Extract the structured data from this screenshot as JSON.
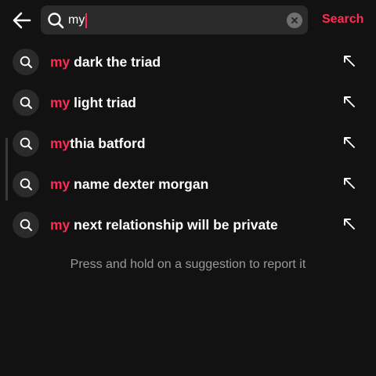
{
  "search": {
    "query": "my",
    "button_label": "Search"
  },
  "icons": {
    "back": "arrow-left-icon",
    "search": "search-icon",
    "clear": "clear-x-icon",
    "fill": "arrow-up-left-icon"
  },
  "suggestions": [
    {
      "highlight": "my",
      "rest": " dark the triad"
    },
    {
      "highlight": "my",
      "rest": " light triad"
    },
    {
      "highlight": "my",
      "rest": "thia batford"
    },
    {
      "highlight": "my",
      "rest": " name dexter morgan"
    },
    {
      "highlight": "my",
      "rest": " next relationship will be private"
    }
  ],
  "hint": "Press and hold on a suggestion to report it",
  "colors": {
    "background": "#121212",
    "accent": "#fe2c55",
    "field": "#2b2b2b",
    "muted_text": "#9a9a9a"
  }
}
